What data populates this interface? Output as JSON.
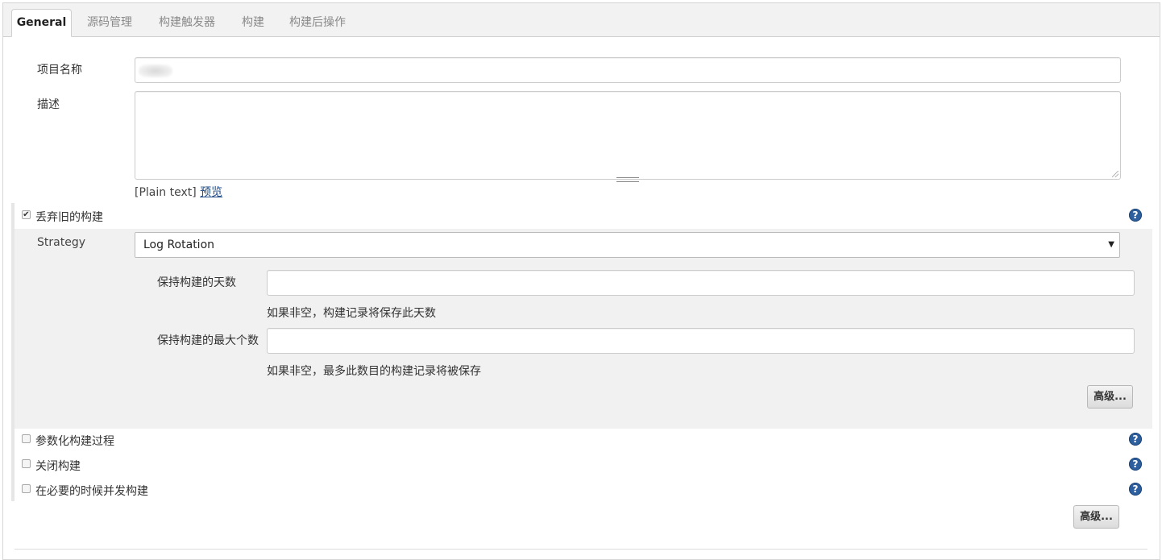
{
  "tabs": [
    {
      "label": "General"
    },
    {
      "label": "源码管理"
    },
    {
      "label": "构建触发器"
    },
    {
      "label": "构建"
    },
    {
      "label": "构建后操作"
    }
  ],
  "project_name": {
    "label": "项目名称",
    "value": ""
  },
  "description": {
    "label": "描述",
    "value": "",
    "format_text": "[Plain text]",
    "preview_link": "预览"
  },
  "discard_old_builds": {
    "label": "丢弃旧的构建",
    "checked": true,
    "strategy_label": "Strategy",
    "strategy_value": "Log Rotation",
    "days_label": "保持构建的天数",
    "days_value": "",
    "days_hint": "如果非空，构建记录将保存此天数",
    "max_label": "保持构建的最大个数",
    "max_value": "",
    "max_hint": "如果非空，最多此数目的构建记录将被保存",
    "advanced_button": "高级..."
  },
  "options": [
    {
      "label": "参数化构建过程",
      "checked": false
    },
    {
      "label": "关闭构建",
      "checked": false
    },
    {
      "label": "在必要的时候并发构建",
      "checked": false
    }
  ],
  "advanced_button": "高级...",
  "help_icon_text": "?"
}
